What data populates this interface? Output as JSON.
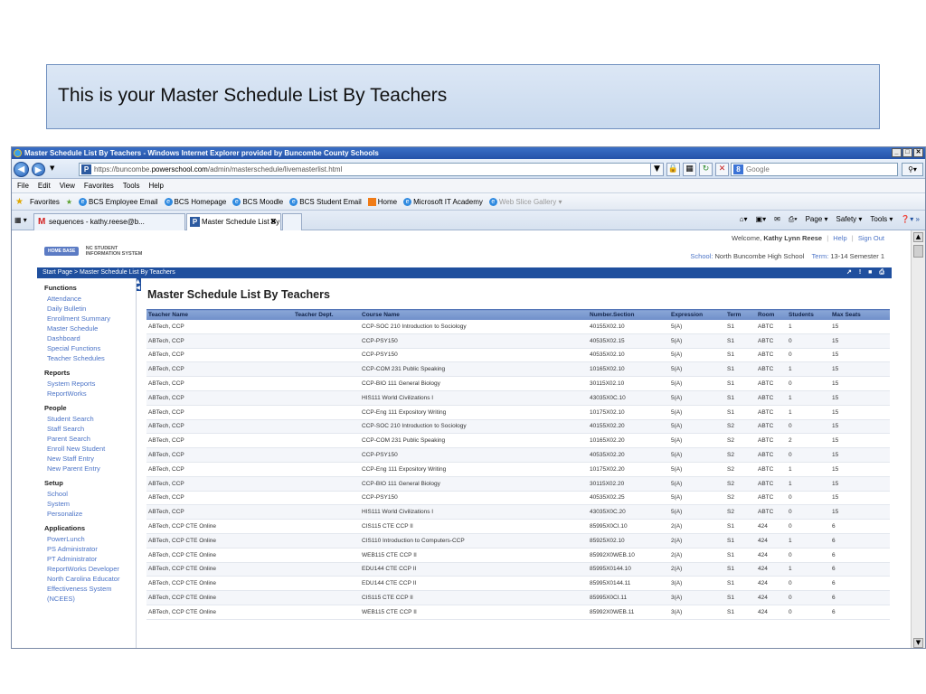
{
  "slide": {
    "caption": "This is your Master Schedule List By Teachers"
  },
  "browser": {
    "title": "Master Schedule List By Teachers - Windows Internet Explorer provided by Buncombe County Schools",
    "window_buttons": [
      "_",
      "□",
      "✕"
    ],
    "url_prefix": "https://buncombe.",
    "url_domain": "powerschool.com",
    "url_path": "/admin/masterschedule/livemasterlist.html",
    "search_placeholder": "Google",
    "menu": [
      "File",
      "Edit",
      "View",
      "Favorites",
      "Tools",
      "Help"
    ],
    "favorites_label": "Favorites",
    "favorites": [
      "BCS Employee Email",
      "BCS Homepage",
      "BCS Moodle",
      "BCS Student Email",
      "Home",
      "Microsoft IT Academy",
      "Web Slice Gallery ▾"
    ],
    "tabs": [
      {
        "label": "sequences - kathy.reese@b..."
      },
      {
        "label": "Master Schedule List By ..."
      }
    ],
    "command_bar": [
      "Page ▾",
      "Safety ▾",
      "Tools ▾"
    ]
  },
  "header": {
    "logo_badge": "HOME BASE",
    "logo_line1": "NC STUDENT",
    "logo_line2": "INFORMATION SYSTEM",
    "welcome_prefix": "Welcome,",
    "user_name": "Kathy Lynn Reese",
    "help_link": "Help",
    "signout_link": "Sign Out",
    "school_label": "School:",
    "school_name": "North Buncombe High School",
    "term_label": "Term:",
    "term_value": "13-14 Semester 1"
  },
  "breadcrumb": "Start Page > Master Schedule List By Teachers",
  "sidebar": [
    {
      "heading": "Functions",
      "items": [
        "Attendance",
        "Daily Bulletin",
        "Enrollment Summary",
        "Master Schedule",
        "Dashboard",
        "Special Functions",
        "Teacher Schedules"
      ]
    },
    {
      "heading": "Reports",
      "items": [
        "System Reports",
        "ReportWorks"
      ]
    },
    {
      "heading": "People",
      "items": [
        "Student Search",
        "Staff Search",
        "Parent Search",
        "Enroll New Student",
        "New Staff Entry",
        "New Parent Entry"
      ]
    },
    {
      "heading": "Setup",
      "items": [
        "School",
        "System",
        "Personalize"
      ]
    },
    {
      "heading": "Applications",
      "items": [
        "PowerLunch",
        "PS Administrator",
        "PT Administrator",
        "ReportWorks Developer",
        "North Carolina Educator",
        "Effectiveness System",
        "(NCEES)"
      ]
    }
  ],
  "main": {
    "title": "Master Schedule List By Teachers",
    "columns": [
      "Teacher Name",
      "Teacher Dept.",
      "Course Name",
      "Number.Section",
      "Expression",
      "Term",
      "Room",
      "Students",
      "Max Seats"
    ],
    "rows": [
      [
        "ABTech, CCP",
        "",
        "CCP-SOC 210 Introduction to Sociology",
        "40155X02.10",
        "5(A)",
        "S1",
        "ABTC",
        "1",
        "15"
      ],
      [
        "ABTech, CCP",
        "",
        "CCP-PSY150",
        "40535X02.15",
        "5(A)",
        "S1",
        "ABTC",
        "0",
        "15"
      ],
      [
        "ABTech, CCP",
        "",
        "CCP-PSY150",
        "40535X02.10",
        "5(A)",
        "S1",
        "ABTC",
        "0",
        "15"
      ],
      [
        "ABTech, CCP",
        "",
        "CCP-COM 231 Public Speaking",
        "10165X02.10",
        "5(A)",
        "S1",
        "ABTC",
        "1",
        "15"
      ],
      [
        "ABTech, CCP",
        "",
        "CCP-BIO 111 General Biology",
        "30115X02.10",
        "5(A)",
        "S1",
        "ABTC",
        "0",
        "15"
      ],
      [
        "ABTech, CCP",
        "",
        "HIS111 World Civilizations I",
        "43035X0C.10",
        "5(A)",
        "S1",
        "ABTC",
        "1",
        "15"
      ],
      [
        "ABTech, CCP",
        "",
        "CCP-Eng 111 Expository Writing",
        "10175X02.10",
        "5(A)",
        "S1",
        "ABTC",
        "1",
        "15"
      ],
      [
        "ABTech, CCP",
        "",
        "CCP-SOC 210 Introduction to Sociology",
        "40155X02.20",
        "5(A)",
        "S2",
        "ABTC",
        "0",
        "15"
      ],
      [
        "ABTech, CCP",
        "",
        "CCP-COM 231 Public Speaking",
        "10165X02.20",
        "5(A)",
        "S2",
        "ABTC",
        "2",
        "15"
      ],
      [
        "ABTech, CCP",
        "",
        "CCP-PSY150",
        "40535X02.20",
        "5(A)",
        "S2",
        "ABTC",
        "0",
        "15"
      ],
      [
        "ABTech, CCP",
        "",
        "CCP-Eng 111 Expository Writing",
        "10175X02.20",
        "5(A)",
        "S2",
        "ABTC",
        "1",
        "15"
      ],
      [
        "ABTech, CCP",
        "",
        "CCP-BIO 111 General Biology",
        "30115X02.20",
        "5(A)",
        "S2",
        "ABTC",
        "1",
        "15"
      ],
      [
        "ABTech, CCP",
        "",
        "CCP-PSY150",
        "40535X02.25",
        "5(A)",
        "S2",
        "ABTC",
        "0",
        "15"
      ],
      [
        "ABTech, CCP",
        "",
        "HIS111 World Civilizations I",
        "43035X0C.20",
        "5(A)",
        "S2",
        "ABTC",
        "0",
        "15"
      ],
      [
        "ABTech, CCP CTE Online",
        "",
        "CIS115 CTE CCP II",
        "85995X0CI.10",
        "2(A)",
        "S1",
        "424",
        "0",
        "6"
      ],
      [
        "ABTech, CCP CTE Online",
        "",
        "CIS110 Introduction to Computers-CCP",
        "85925X02.10",
        "2(A)",
        "S1",
        "424",
        "1",
        "6"
      ],
      [
        "ABTech, CCP CTE Online",
        "",
        "WEB115 CTE CCP II",
        "85992X0WEB.10",
        "2(A)",
        "S1",
        "424",
        "0",
        "6"
      ],
      [
        "ABTech, CCP CTE Online",
        "",
        "EDU144 CTE CCP II",
        "85995X0144.10",
        "2(A)",
        "S1",
        "424",
        "1",
        "6"
      ],
      [
        "ABTech, CCP CTE Online",
        "",
        "EDU144 CTE CCP II",
        "85995X0144.11",
        "3(A)",
        "S1",
        "424",
        "0",
        "6"
      ],
      [
        "ABTech, CCP CTE Online",
        "",
        "CIS115 CTE CCP II",
        "85995X0CI.11",
        "3(A)",
        "S1",
        "424",
        "0",
        "6"
      ],
      [
        "ABTech, CCP CTE Online",
        "",
        "WEB115 CTE CCP II",
        "85992X0WEB.11",
        "3(A)",
        "S1",
        "424",
        "0",
        "6"
      ]
    ]
  }
}
